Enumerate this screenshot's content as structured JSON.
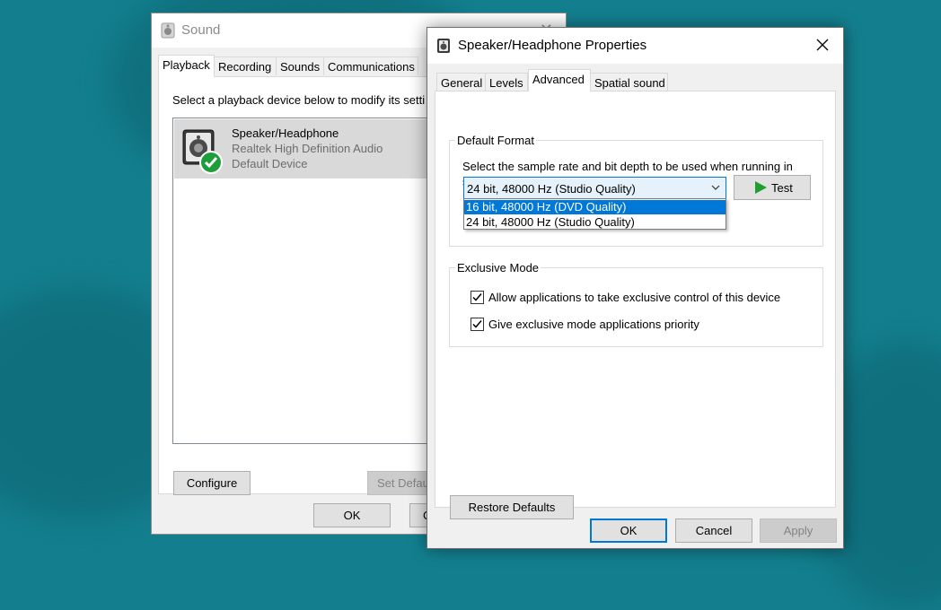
{
  "sound_window": {
    "title": "Sound",
    "close_glyph": "✕",
    "tabs": [
      {
        "label": "Playback",
        "active": true
      },
      {
        "label": "Recording"
      },
      {
        "label": "Sounds"
      },
      {
        "label": "Communications"
      }
    ],
    "instruction": "Select a playback device below to modify its setti",
    "device": {
      "name": "Speaker/Headphone",
      "driver": "Realtek High Definition Audio",
      "status": "Default Device",
      "icon": "speaker-icon",
      "badge_icon": "green-check-icon"
    },
    "buttons": {
      "configure": "Configure",
      "set_default": "Set Defau",
      "ok": "OK",
      "cancel": "C"
    }
  },
  "props_window": {
    "title": "Speaker/Headphone Properties",
    "tabs": [
      {
        "label": "General"
      },
      {
        "label": "Levels"
      },
      {
        "label": "Advanced",
        "active": true
      },
      {
        "label": "Spatial sound"
      }
    ],
    "default_format": {
      "group_label": "Default Format",
      "description": "Select the sample rate and bit depth to be used when running in shared mode.",
      "selected": "24 bit, 48000 Hz (Studio Quality)",
      "options": [
        {
          "label": "16 bit, 48000 Hz (DVD Quality)",
          "highlighted": true
        },
        {
          "label": "24 bit, 48000 Hz (Studio Quality)"
        }
      ],
      "test_button": "Test"
    },
    "exclusive_mode": {
      "group_label": "Exclusive Mode",
      "allow_exclusive": {
        "label": "Allow applications to take exclusive control of this device",
        "checked": true
      },
      "give_priority": {
        "label": "Give exclusive mode applications priority",
        "checked": true
      }
    },
    "restore_defaults": "Restore Defaults",
    "buttons": {
      "ok": "OK",
      "cancel": "Cancel",
      "apply": "Apply"
    }
  },
  "colors": {
    "desktop": "#137f8e",
    "accent": "#0078d7",
    "check_green": "#1e9e3a",
    "play_green": "#1e9e2c"
  }
}
